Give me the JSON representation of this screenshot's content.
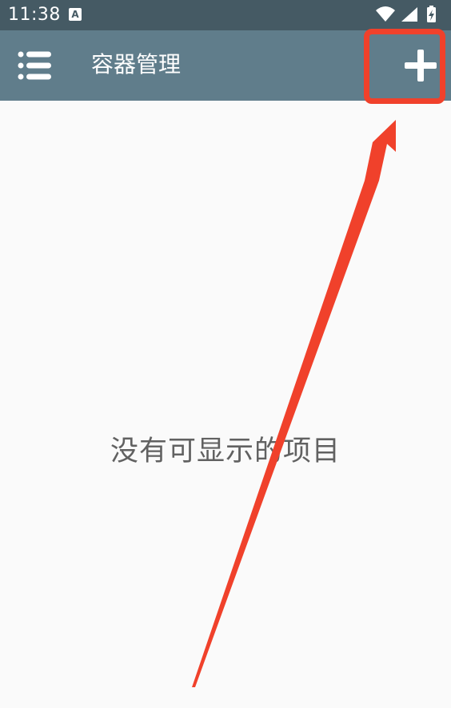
{
  "status_bar": {
    "time": "11:38",
    "notification_letter": "A",
    "icons": [
      "wifi-icon",
      "signal-icon",
      "battery-charging-icon"
    ],
    "background_color": "#455a64"
  },
  "app_bar": {
    "title": "容器管理",
    "menu_icon": "list-menu-icon",
    "add_icon": "plus-icon",
    "background_color": "#607d8b"
  },
  "main": {
    "empty_message": "没有可显示的项目"
  },
  "annotation": {
    "highlight_color": "#f0412b"
  }
}
